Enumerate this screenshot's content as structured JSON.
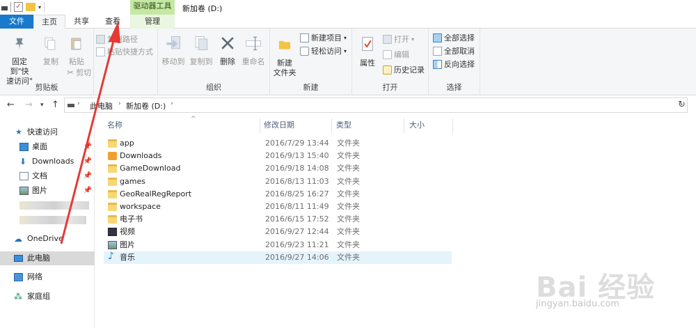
{
  "window": {
    "title": "新加卷 (D:)",
    "context_tab_header": "驱动器工具"
  },
  "tabs": [
    {
      "label": "文件"
    },
    {
      "label": "主页"
    },
    {
      "label": "共享"
    },
    {
      "label": "查看"
    },
    {
      "label": "管理"
    }
  ],
  "ribbon": {
    "clipboard": {
      "label": "剪贴板",
      "pin": "固定到\"快",
      "pin2": "速访问\"",
      "copy": "复制",
      "paste": "粘贴",
      "copy_path": "复制路径",
      "paste_shortcut": "粘贴快捷方式",
      "cut": "剪切"
    },
    "organize": {
      "label": "组织",
      "move_to": "移动到",
      "copy_to": "复制到",
      "delete": "删除",
      "rename": "重命名"
    },
    "new": {
      "label": "新建",
      "new_folder_1": "新建",
      "new_folder_2": "文件夹",
      "new_item": "新建项目",
      "easy_access": "轻松访问"
    },
    "open": {
      "label": "打开",
      "properties": "属性",
      "open": "打开",
      "edit": "编辑",
      "history": "历史记录"
    },
    "select": {
      "label": "选择",
      "select_all": "全部选择",
      "select_none": "全部取消",
      "invert": "反向选择"
    }
  },
  "address": {
    "segments": [
      "此电脑",
      "新加卷 (D:)"
    ]
  },
  "navpane": {
    "quick_access": "快速访问",
    "desktop": "桌面",
    "downloads": "Downloads",
    "documents": "文档",
    "pictures": "图片",
    "onedrive": "OneDrive",
    "this_pc": "此电脑",
    "network": "网络",
    "homegroup": "家庭组"
  },
  "columns": {
    "name": "名称",
    "date": "修改日期",
    "type": "类型",
    "size": "大小"
  },
  "files": [
    {
      "name": "app",
      "date": "2016/7/29 13:44",
      "type": "文件夹",
      "icon": "folder"
    },
    {
      "name": "Downloads",
      "date": "2016/9/13 15:40",
      "type": "文件夹",
      "icon": "downloads-folder"
    },
    {
      "name": "GameDownload",
      "date": "2016/9/18 14:08",
      "type": "文件夹",
      "icon": "folder"
    },
    {
      "name": "games",
      "date": "2016/8/13 11:03",
      "type": "文件夹",
      "icon": "folder"
    },
    {
      "name": "GeoRealRegReport",
      "date": "2016/8/25 16:27",
      "type": "文件夹",
      "icon": "folder"
    },
    {
      "name": "workspace",
      "date": "2016/8/11 11:49",
      "type": "文件夹",
      "icon": "folder"
    },
    {
      "name": "电子书",
      "date": "2016/6/15 17:52",
      "type": "文件夹",
      "icon": "folder"
    },
    {
      "name": "视频",
      "date": "2016/9/27 12:44",
      "type": "文件夹",
      "icon": "video-folder"
    },
    {
      "name": "图片",
      "date": "2016/9/23 11:21",
      "type": "文件夹",
      "icon": "pictures-folder"
    },
    {
      "name": "音乐",
      "date": "2016/9/27 14:06",
      "type": "文件夹",
      "icon": "music-folder"
    }
  ],
  "watermark": {
    "brand": "Bai 经验",
    "url": "jingyan.baidu.com"
  },
  "colors": {
    "file_tab": "#1979ca",
    "context_tab": "#c5e8a5",
    "selection": "#e5f3fb",
    "annotation": "#e53935"
  }
}
